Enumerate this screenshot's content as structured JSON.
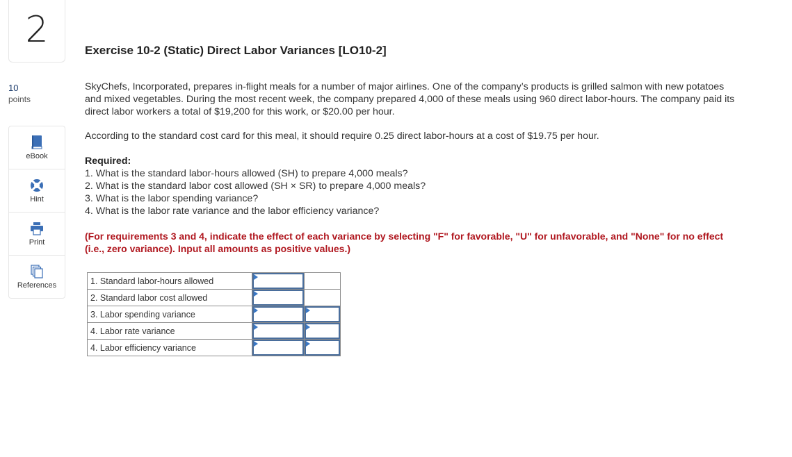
{
  "question": {
    "number": "2",
    "points_value": "10",
    "points_label": "points"
  },
  "tools": [
    {
      "label": "eBook",
      "icon": "book-icon"
    },
    {
      "label": "Hint",
      "icon": "lifebuoy-icon"
    },
    {
      "label": "Print",
      "icon": "printer-icon"
    },
    {
      "label": "References",
      "icon": "documents-icon"
    }
  ],
  "exercise": {
    "title": "Exercise 10-2 (Static) Direct Labor Variances [LO10-2]",
    "paragraph1": "SkyChefs, Incorporated, prepares in-flight meals for a number of major airlines. One of the company’s products is grilled salmon with new potatoes and mixed vegetables. During the most recent week, the company prepared 4,000 of these meals using 960 direct labor-hours. The company paid its direct labor workers a total of $19,200 for this work, or $20.00 per hour.",
    "paragraph2": "According to the standard cost card for this meal, it should require 0.25 direct labor-hours at a cost of $19.75 per hour.",
    "required_heading": "Required:",
    "requirements": [
      "1. What is the standard labor-hours allowed (SH) to prepare 4,000 meals?",
      "2. What is the standard labor cost allowed (SH × SR) to prepare 4,000 meals?",
      "3. What is the labor spending variance?",
      "4. What is the labor rate variance and the labor efficiency variance?"
    ],
    "instructions": "(For requirements 3 and 4, indicate the effect of each variance by selecting \"F\" for favorable, \"U\" for unfavorable, and \"None\" for no effect (i.e., zero variance). Input all amounts as positive values.)"
  },
  "answer_table": {
    "rows": [
      {
        "label": "1. Standard labor-hours allowed",
        "amount": "",
        "effect": null
      },
      {
        "label": "2. Standard labor cost allowed",
        "amount": "",
        "effect": null
      },
      {
        "label": "3. Labor spending variance",
        "amount": "",
        "effect": ""
      },
      {
        "label": "4. Labor rate variance",
        "amount": "",
        "effect": ""
      },
      {
        "label": "4. Labor efficiency variance",
        "amount": "",
        "effect": ""
      }
    ]
  },
  "colors": {
    "accent_blue": "#3b78c4",
    "input_border": "#4a6e9c",
    "instruction_red": "#b0171f"
  }
}
